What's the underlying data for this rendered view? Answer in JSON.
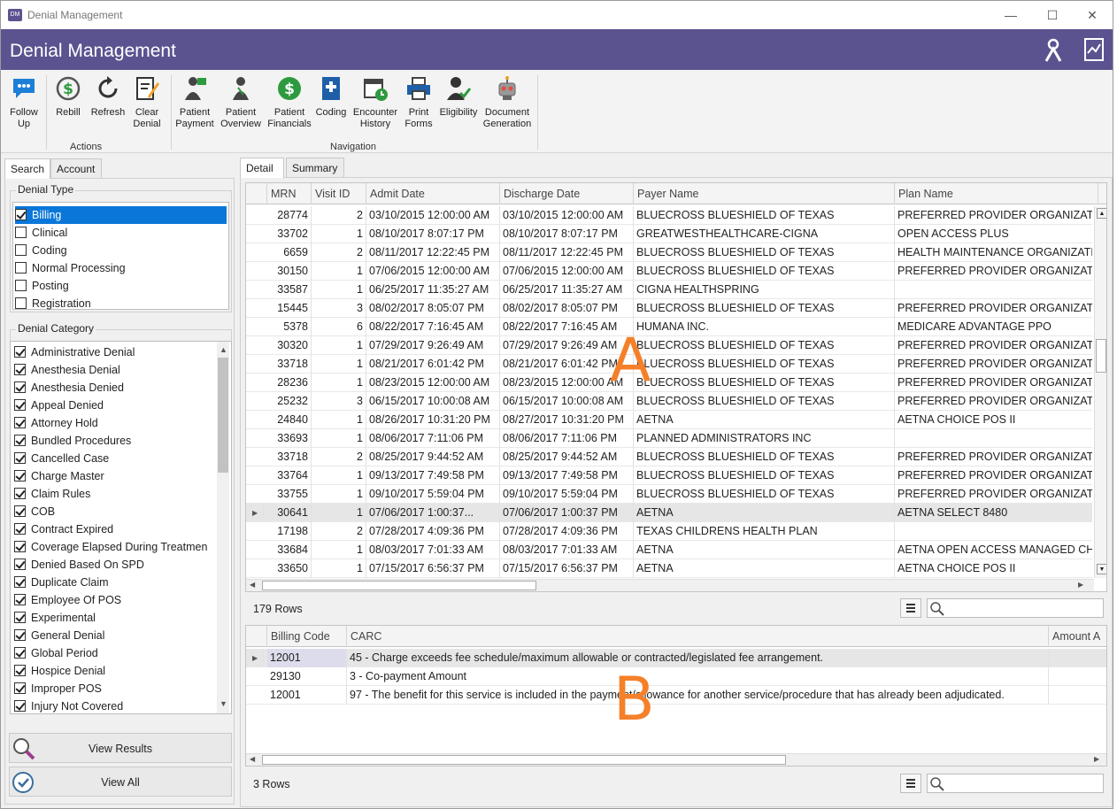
{
  "window": {
    "title": "Denial Management",
    "app_badge": "DM"
  },
  "header": {
    "title": "Denial Management"
  },
  "ribbon": {
    "actions_label": "Actions",
    "navigation_label": "Navigation",
    "buttons": [
      {
        "l1": "Follow",
        "l2": "Up"
      },
      {
        "l1": "Rebill",
        "l2": ""
      },
      {
        "l1": "Refresh",
        "l2": ""
      },
      {
        "l1": "Clear",
        "l2": "Denial"
      },
      {
        "l1": "Patient",
        "l2": "Payment"
      },
      {
        "l1": "Patient",
        "l2": "Overview"
      },
      {
        "l1": "Patient",
        "l2": "Financials"
      },
      {
        "l1": "Coding",
        "l2": ""
      },
      {
        "l1": "Encounter",
        "l2": "History"
      },
      {
        "l1": "Print",
        "l2": "Forms"
      },
      {
        "l1": "Eligibility",
        "l2": ""
      },
      {
        "l1": "Document",
        "l2": "Generation"
      }
    ]
  },
  "left": {
    "tabs": [
      "Search",
      "Account"
    ],
    "denial_type": {
      "title": "Denial Type",
      "items": [
        {
          "label": "Billing",
          "checked": true
        },
        {
          "label": "Clinical",
          "checked": false
        },
        {
          "label": "Coding",
          "checked": false
        },
        {
          "label": "Normal Processing",
          "checked": false
        },
        {
          "label": "Posting",
          "checked": false
        },
        {
          "label": "Registration",
          "checked": false
        }
      ]
    },
    "denial_category": {
      "title": "Denial Category",
      "items": [
        "Administrative Denial",
        "Anesthesia Denial",
        "Anesthesia Denied",
        "Appeal Denied",
        "Attorney Hold",
        "Bundled Procedures",
        "Cancelled Case",
        "Charge Master",
        "Claim Rules",
        "COB",
        "Contract Expired",
        "Coverage Elapsed During Treatmen",
        "Denied Based On SPD",
        "Duplicate Claim",
        "Employee Of POS",
        "Experimental",
        "General Denial",
        "Global Period",
        "Hospice Denial",
        "Improper POS",
        "Injury Not Covered"
      ]
    },
    "view_results": "View Results",
    "view_all": "View All"
  },
  "right": {
    "tabs": [
      "Detail",
      "Summary"
    ],
    "grid_a": {
      "columns": [
        "MRN",
        "Visit ID",
        "Admit Date",
        "Discharge Date",
        "Payer Name",
        "Plan Name"
      ],
      "rows": [
        [
          "28774",
          "2",
          "03/10/2015 12:00:00 AM",
          "03/10/2015 12:00:00 AM",
          "BLUECROSS BLUESHIELD OF TEXAS",
          "PREFERRED PROVIDER ORGANIZATIO"
        ],
        [
          "33702",
          "1",
          "08/10/2017 8:07:17 PM",
          "08/10/2017 8:07:17 PM",
          "GREATWESTHEALTHCARE-CIGNA",
          "OPEN ACCESS PLUS"
        ],
        [
          "6659",
          "2",
          "08/11/2017 12:22:45 PM",
          "08/11/2017 12:22:45 PM",
          "BLUECROSS BLUESHIELD OF TEXAS",
          "HEALTH MAINTENANCE ORGANIZATI"
        ],
        [
          "30150",
          "1",
          "07/06/2015 12:00:00 AM",
          "07/06/2015 12:00:00 AM",
          "BLUECROSS BLUESHIELD OF TEXAS",
          "PREFERRED PROVIDER ORGANIZATIO"
        ],
        [
          "33587",
          "1",
          "06/25/2017 11:35:27 AM",
          "06/25/2017 11:35:27 AM",
          "CIGNA HEALTHSPRING",
          ""
        ],
        [
          "15445",
          "3",
          "08/02/2017 8:05:07 PM",
          "08/02/2017 8:05:07 PM",
          "BLUECROSS BLUESHIELD OF TEXAS",
          "PREFERRED PROVIDER ORGANIZATIO"
        ],
        [
          "5378",
          "6",
          "08/22/2017 7:16:45 AM",
          "08/22/2017 7:16:45 AM",
          "HUMANA INC.",
          "MEDICARE ADVANTAGE PPO"
        ],
        [
          "30320",
          "1",
          "07/29/2017 9:26:49 AM",
          "07/29/2017 9:26:49 AM",
          "BLUECROSS BLUESHIELD OF TEXAS",
          "PREFERRED PROVIDER ORGANIZATIO"
        ],
        [
          "33718",
          "1",
          "08/21/2017 6:01:42 PM",
          "08/21/2017 6:01:42 PM",
          "BLUECROSS BLUESHIELD OF TEXAS",
          "PREFERRED PROVIDER ORGANIZATIO"
        ],
        [
          "28236",
          "1",
          "08/23/2015 12:00:00 AM",
          "08/23/2015 12:00:00 AM",
          "BLUECROSS BLUESHIELD OF TEXAS",
          "PREFERRED PROVIDER ORGANIZATIO"
        ],
        [
          "25232",
          "3",
          "06/15/2017 10:00:08 AM",
          "06/15/2017 10:00:08 AM",
          "BLUECROSS BLUESHIELD OF TEXAS",
          "PREFERRED PROVIDER ORGANIZATIO"
        ],
        [
          "24840",
          "1",
          "08/26/2017 10:31:20 PM",
          "08/27/2017 10:31:20 PM",
          "AETNA",
          "AETNA CHOICE POS II"
        ],
        [
          "33693",
          "1",
          "08/06/2017 7:11:06 PM",
          "08/06/2017 7:11:06 PM",
          "PLANNED ADMINISTRATORS INC",
          ""
        ],
        [
          "33718",
          "2",
          "08/25/2017 9:44:52 AM",
          "08/25/2017 9:44:52 AM",
          "BLUECROSS BLUESHIELD OF TEXAS",
          "PREFERRED PROVIDER ORGANIZATIO"
        ],
        [
          "33764",
          "1",
          "09/13/2017 7:49:58 PM",
          "09/13/2017 7:49:58 PM",
          "BLUECROSS BLUESHIELD OF TEXAS",
          "PREFERRED PROVIDER ORGANIZATIO"
        ],
        [
          "33755",
          "1",
          "09/10/2017 5:59:04 PM",
          "09/10/2017 5:59:04 PM",
          "BLUECROSS BLUESHIELD OF TEXAS",
          "PREFERRED PROVIDER ORGANIZATIO"
        ],
        [
          "30641",
          "1",
          "07/06/2017 1:00:37...",
          "07/06/2017 1:00:37 PM",
          "AETNA",
          "AETNA SELECT 8480"
        ],
        [
          "17198",
          "2",
          "07/28/2017 4:09:36 PM",
          "07/28/2017 4:09:36 PM",
          "TEXAS CHILDRENS HEALTH PLAN",
          ""
        ],
        [
          "33684",
          "1",
          "08/03/2017 7:01:33 AM",
          "08/03/2017 7:01:33 AM",
          "AETNA",
          "AETNA OPEN ACCESS MANAGED CH"
        ],
        [
          "33650",
          "1",
          "07/15/2017 6:56:37 PM",
          "07/15/2017 6:56:37 PM",
          "AETNA",
          "AETNA CHOICE POS II"
        ]
      ],
      "current_row": 16,
      "row_count": "179 Rows"
    },
    "grid_b": {
      "columns": [
        "Billing Code",
        "CARC",
        "Amount A"
      ],
      "rows": [
        [
          "12001",
          "45 - Charge exceeds fee schedule/maximum allowable or contracted/legislated fee arrangement.",
          ""
        ],
        [
          "29130",
          "3 - Co-payment Amount",
          ""
        ],
        [
          "12001",
          "97 - The benefit for this service is included in the payment/allowance for another service/procedure that has already been adjudicated.",
          ""
        ]
      ],
      "row_count": "3 Rows"
    },
    "overlay_a": "A",
    "overlay_b": "B"
  }
}
